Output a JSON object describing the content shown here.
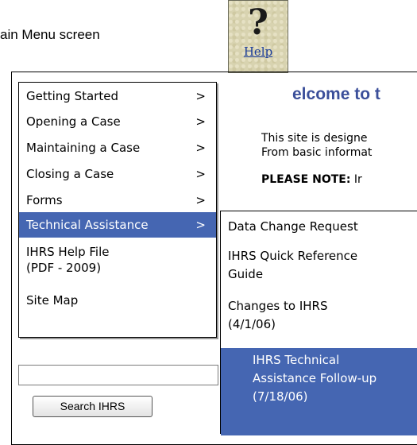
{
  "caption": "ain Menu screen",
  "help": {
    "label": "Help",
    "icon": "question-mark-icon"
  },
  "welcome": "elcome to t",
  "body": {
    "line1": "This site is designe",
    "line2": "From basic informat",
    "note_label": "PLEASE NOTE:",
    "note_rest": " Ir"
  },
  "menu": {
    "items": [
      {
        "label": "Getting Started",
        "arrow": ">"
      },
      {
        "label": "Opening a Case",
        "arrow": ">"
      },
      {
        "label": "Maintaining a Case",
        "arrow": ">"
      },
      {
        "label": "Closing a Case",
        "arrow": ">"
      },
      {
        "label": "Forms",
        "arrow": ">"
      },
      {
        "label": "Technical Assistance",
        "arrow": ">"
      },
      {
        "label": "IHRS Help File (PDF - 2009)",
        "line1": "IHRS Help File",
        "line2": "(PDF - 2009)"
      },
      {
        "label": "Site Map"
      }
    ],
    "selected_index": 5
  },
  "submenu": {
    "items": [
      {
        "line1": "Data Change Request"
      },
      {
        "line1": "IHRS Quick Reference",
        "line2": "Guide"
      },
      {
        "line1": "Changes to IHRS",
        "line2": "(4/1/06)"
      },
      {
        "line1": "IHRS Technical",
        "line2": "Assistance Follow-up",
        "line3": "(7/18/06)"
      }
    ],
    "selected_index": 3
  },
  "search": {
    "value": "",
    "button_label": "Search IHRS"
  },
  "colors": {
    "menu_highlight": "#4566b2",
    "welcome_title": "#3b4f9a",
    "help_link": "#1a3c9a"
  }
}
